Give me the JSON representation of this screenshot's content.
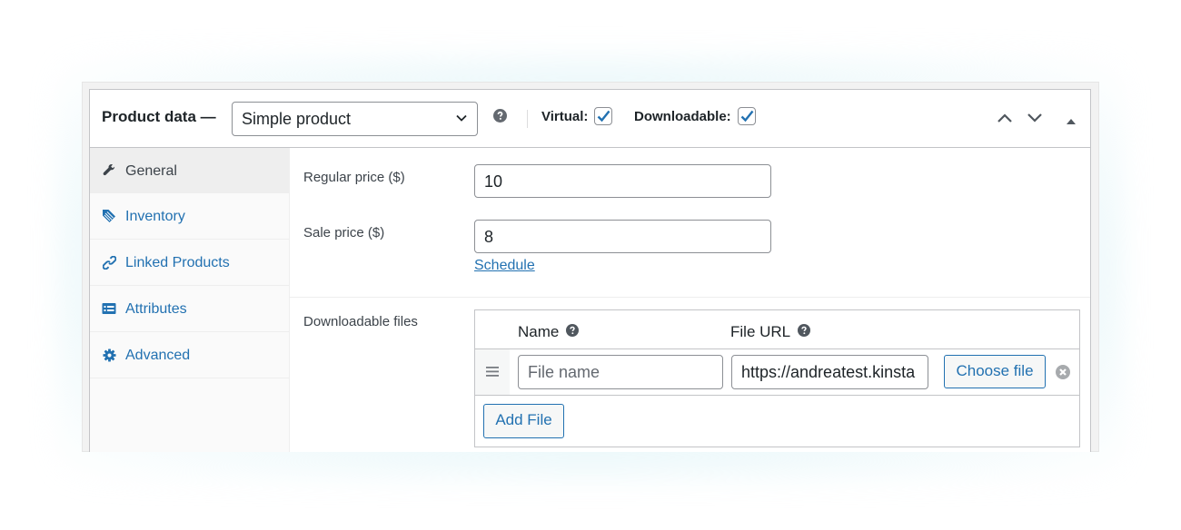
{
  "header": {
    "title": "Product data —",
    "product_type": {
      "selected": "Simple product",
      "icon": "chevron-down-icon"
    },
    "help_icon": "help-icon",
    "virtual": {
      "label": "Virtual:",
      "checked": true
    },
    "downloadable": {
      "label": "Downloadable:",
      "checked": true
    },
    "controls": [
      {
        "name": "move-up",
        "icon": "chevron-up-icon"
      },
      {
        "name": "move-down",
        "icon": "chevron-down-icon"
      },
      {
        "name": "toggle-panel",
        "icon": "triangle-up-icon"
      }
    ]
  },
  "sidebar": {
    "items": [
      {
        "label": "General",
        "icon": "wrench-icon",
        "active": true
      },
      {
        "label": "Inventory",
        "icon": "tag-icon",
        "active": false
      },
      {
        "label": "Linked Products",
        "icon": "link-icon",
        "active": false
      },
      {
        "label": "Attributes",
        "icon": "list-card-icon",
        "active": false
      },
      {
        "label": "Advanced",
        "icon": "gear-icon",
        "active": false
      }
    ]
  },
  "general": {
    "regular_price": {
      "label": "Regular price ($)",
      "value": "10"
    },
    "sale_price": {
      "label": "Sale price ($)",
      "value": "8"
    },
    "schedule_link": "Schedule",
    "downloadable_files": {
      "label": "Downloadable files",
      "columns": [
        {
          "label": "Name",
          "help_icon": "help-icon"
        },
        {
          "label": "File URL",
          "help_icon": "help-icon"
        }
      ],
      "rows": [
        {
          "name": {
            "value": "",
            "placeholder": "File name"
          },
          "url": {
            "value": "https://andreatest.kinsta"
          },
          "choose_label": "Choose file",
          "remove_icon": "remove-circle-icon"
        }
      ],
      "add_file_label": "Add File"
    }
  },
  "colors": {
    "accent": "#2271b1",
    "text": "#1d2327",
    "border": "#c3c4c7",
    "sidebar_bg": "#fafafa",
    "active_tab_bg": "#eeeeee",
    "icon_gray": "#50575e"
  }
}
